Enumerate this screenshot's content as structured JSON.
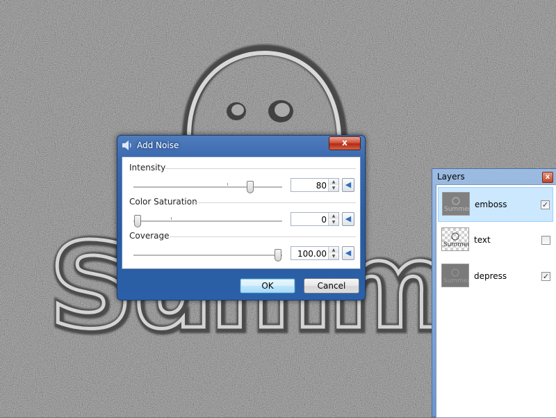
{
  "dialog": {
    "title": "Add Noise",
    "close_label": "x",
    "groups": [
      {
        "label": "Intensity",
        "value": "80",
        "fraction": 0.8,
        "ticks": [
          0.63
        ]
      },
      {
        "label": "Color Saturation",
        "value": "0",
        "fraction": 0.0,
        "ticks": [
          0.25
        ]
      },
      {
        "label": "Coverage",
        "value": "100.00",
        "fraction": 1.0,
        "ticks": []
      }
    ],
    "ok_label": "OK",
    "cancel_label": "Cancel"
  },
  "layers_panel": {
    "title": "Layers",
    "close_label": "x",
    "layers": [
      {
        "name": "emboss",
        "visible": true,
        "selected": true
      },
      {
        "name": "text",
        "visible": false,
        "selected": false
      },
      {
        "name": "depress",
        "visible": true,
        "selected": false
      }
    ],
    "thumbnail_text": "Summer"
  },
  "canvas": {
    "artwork_text": "Summe"
  }
}
